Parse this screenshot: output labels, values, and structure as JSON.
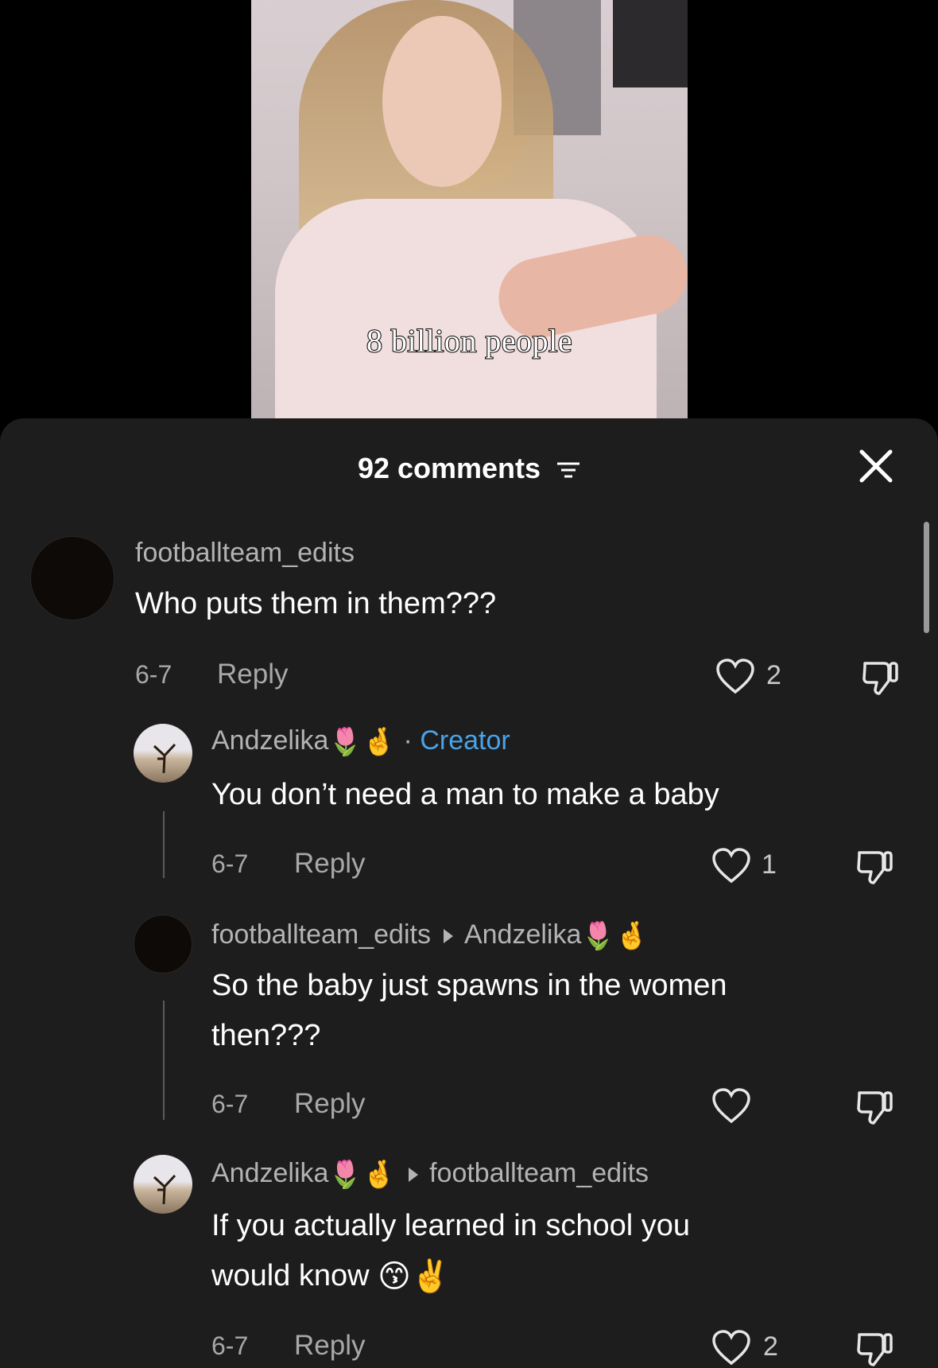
{
  "video": {
    "caption": "8 billion people"
  },
  "comments_sheet": {
    "count_label": "92 comments",
    "comments": [
      {
        "username": "footballteam_edits",
        "text": "Who puts them in them???",
        "date": "6-7",
        "reply_label": "Reply",
        "likes": "2"
      },
      {
        "username": "Andzelika",
        "username_emojis": "🌷🤞",
        "badge_separator": " · ",
        "badge": "Creator",
        "text": "You don’t need a man to make a baby",
        "date": "6-7",
        "reply_label": "Reply",
        "likes": "1"
      },
      {
        "username": "footballteam_edits",
        "reply_to": "Andzelika",
        "reply_to_emojis": "🌷🤞",
        "text_line1": "So the baby just spawns in the women",
        "text_line2": "then???",
        "date": "6-7",
        "reply_label": "Reply",
        "likes": ""
      },
      {
        "username": "Andzelika",
        "username_emojis": "🌷🤞",
        "reply_to": "footballteam_edits",
        "text_line1": "If you actually learned in school you",
        "text_line2": "would know",
        "text_emojis": "😙✌️",
        "date": "6-7",
        "reply_label": "Reply",
        "likes": "2"
      }
    ]
  },
  "icons": [
    "filter-icon",
    "close-icon",
    "heart-icon",
    "dislike-icon"
  ]
}
